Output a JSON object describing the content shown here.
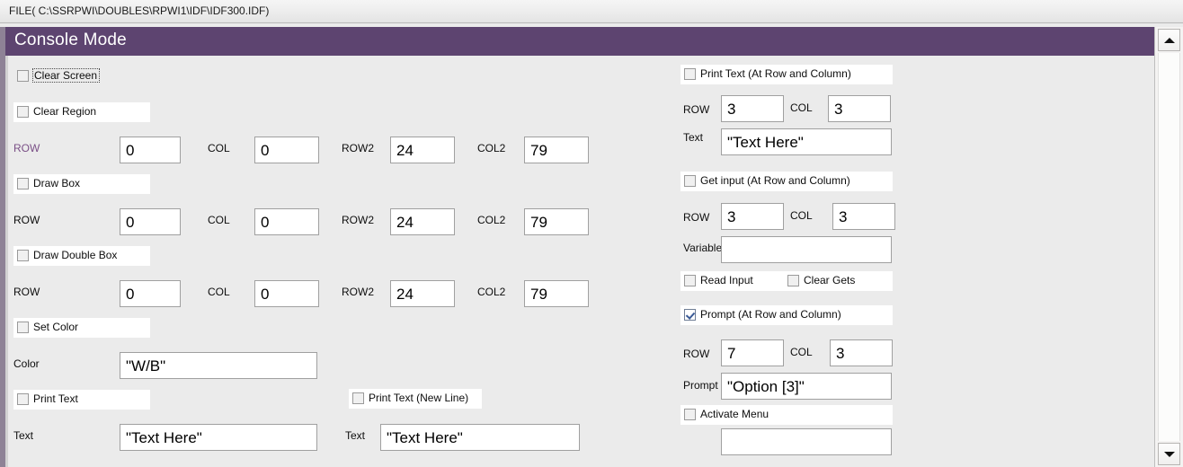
{
  "window": {
    "file_path": "FILE( C:\\SSRPWI\\DOUBLES\\RPWI1\\IDF\\IDF300.IDF)",
    "header_title": "Console Mode",
    "header_color": "#5d4470",
    "accent_label_color": "#7a4f86",
    "checked_color": "#3a5a96"
  },
  "labels": {
    "row": "ROW",
    "col": "COL",
    "row2": "ROW2",
    "col2": "COL2",
    "text": "Text",
    "color": "Color",
    "variable": "Variable",
    "prompt": "Prompt"
  },
  "left_column": {
    "clear_screen": {
      "label": "Clear Screen",
      "checked": false,
      "focused": true
    },
    "clear_region": {
      "label": "Clear Region",
      "checked": false,
      "row": "0",
      "col": "0",
      "row2": "24",
      "col2": "79"
    },
    "draw_box": {
      "label": "Draw Box",
      "checked": false,
      "row": "0",
      "col": "0",
      "row2": "24",
      "col2": "79"
    },
    "draw_double_box": {
      "label": "Draw Double Box",
      "checked": false,
      "row": "0",
      "col": "0",
      "row2": "24",
      "col2": "79"
    },
    "set_color": {
      "label": "Set Color",
      "checked": false,
      "color_value": "\"W/B\""
    },
    "print_text": {
      "label": "Print Text",
      "checked": false,
      "text_value": "\"Text Here\""
    }
  },
  "middle_column": {
    "print_text_new_line": {
      "label": "Print Text (New Line)",
      "checked": false,
      "text_value": "\"Text Here\""
    }
  },
  "right_column": {
    "print_text_at": {
      "label": "Print Text (At Row and Column)",
      "checked": false,
      "row": "3",
      "col": "3",
      "text_value": "\"Text Here\""
    },
    "get_input_at": {
      "label": "Get input (At Row and Column)",
      "checked": false,
      "row": "3",
      "col": "3",
      "variable_value": ""
    },
    "read_input": {
      "label": "Read Input",
      "checked": false
    },
    "clear_gets": {
      "label": "Clear Gets",
      "checked": false
    },
    "prompt_at": {
      "label": "Prompt (At Row and Column)",
      "checked": true,
      "row": "7",
      "col": "3",
      "prompt_value": "\"Option [3]\""
    },
    "activate_menu": {
      "label": "Activate Menu",
      "checked": false,
      "menu_value": ""
    }
  },
  "scrollbar": {
    "up_arrow": "scroll-up-arrow",
    "down_arrow": "scroll-down-arrow"
  }
}
